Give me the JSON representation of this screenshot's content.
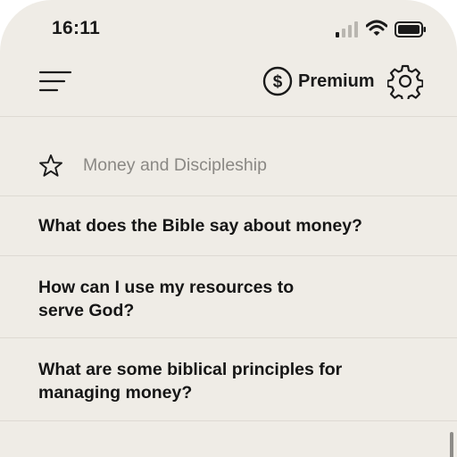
{
  "status_bar": {
    "time": "16:11"
  },
  "toolbar": {
    "menu_icon": "hamburger-menu-icon",
    "premium_icon": "dollar-circle-icon",
    "premium_label": "Premium",
    "settings_icon": "gear-icon"
  },
  "section": {
    "icon": "star-outline-icon",
    "title": "Money and Discipleship"
  },
  "questions": [
    {
      "text": "What does the Bible say about money?"
    },
    {
      "text": "How can I use my resources to serve God?"
    },
    {
      "text": "What are some biblical principles for managing money?"
    }
  ],
  "colors": {
    "background": "#efece6",
    "text": "#1a1a1a",
    "muted": "#8a8884",
    "divider": "#dedad3"
  }
}
